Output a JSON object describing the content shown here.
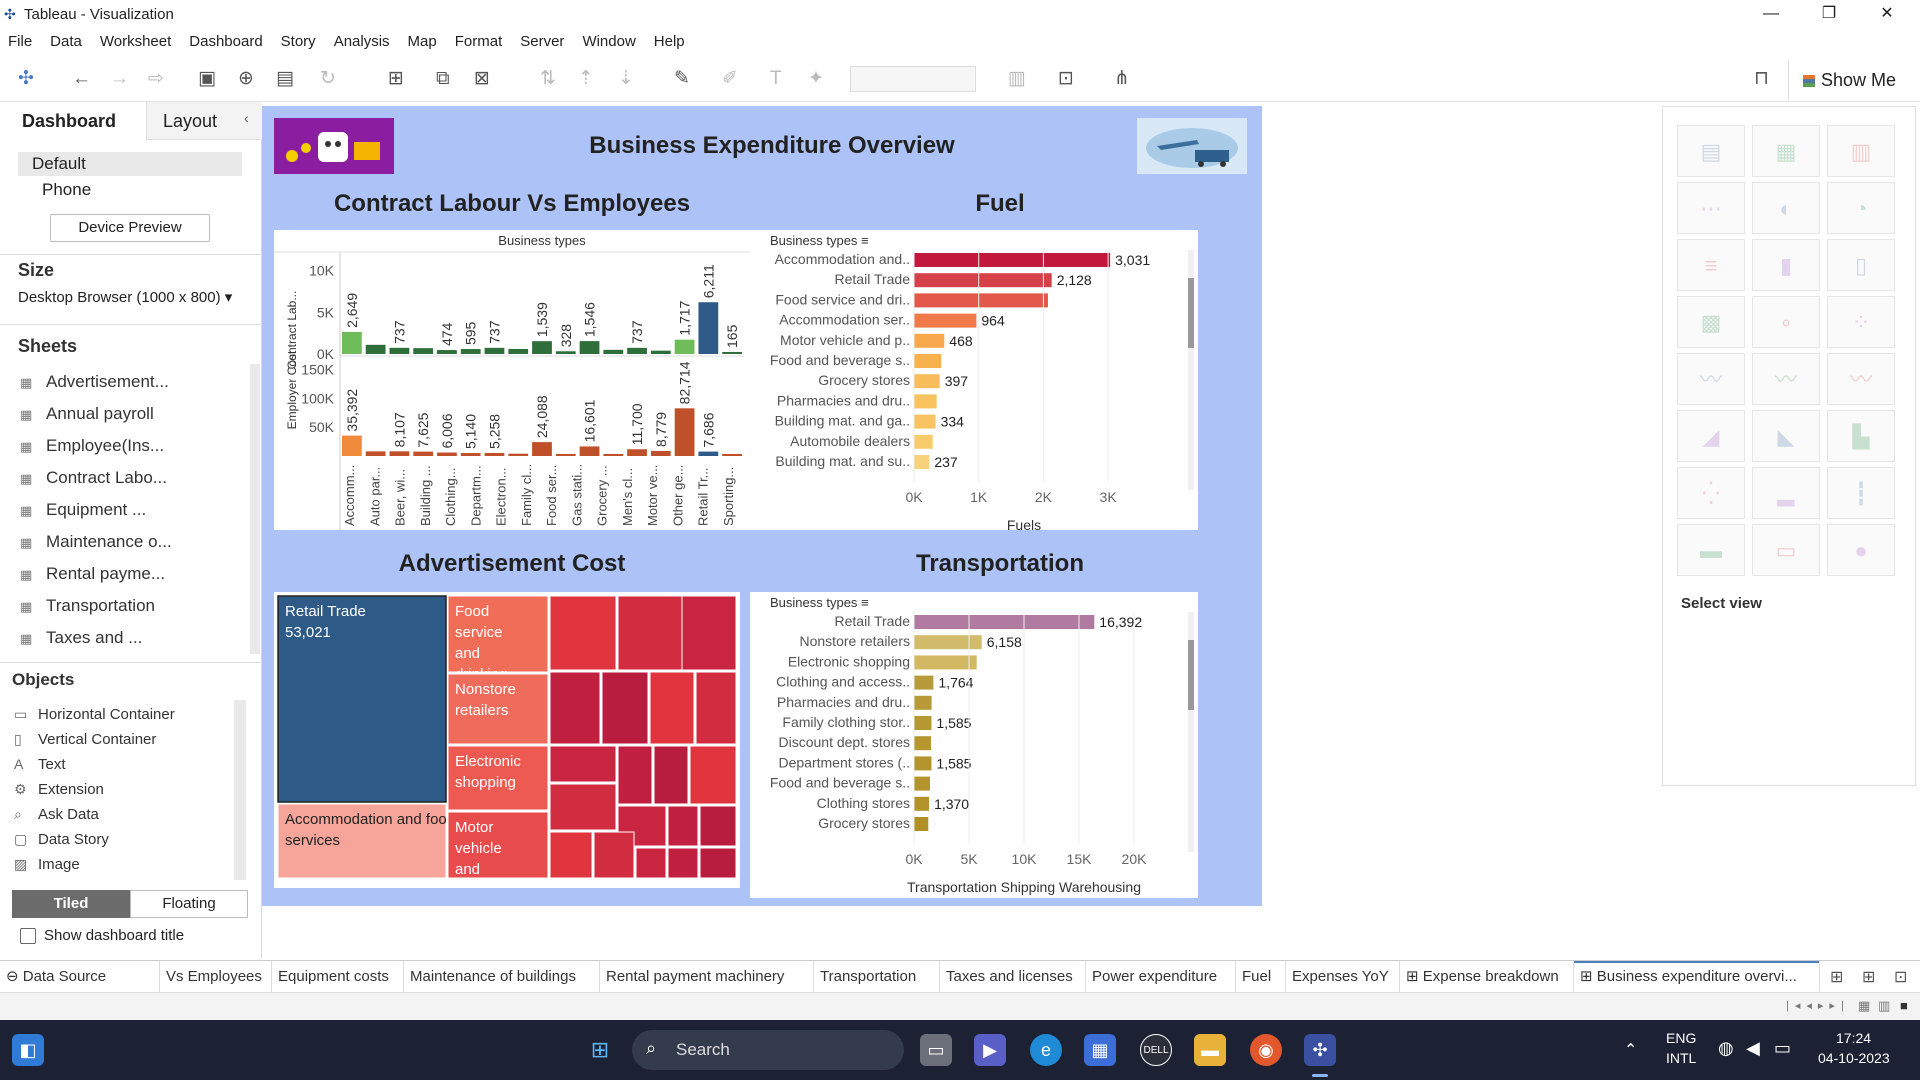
{
  "window": {
    "title": "Tableau - Visualization",
    "minimize": "—",
    "restore": "❐",
    "close": "✕"
  },
  "menu": [
    "File",
    "Data",
    "Worksheet",
    "Dashboard",
    "Story",
    "Analysis",
    "Map",
    "Format",
    "Server",
    "Window",
    "Help"
  ],
  "toolbar": {
    "show_me": "Show Me"
  },
  "left_pane": {
    "tabs": [
      "Dashboard",
      "Layout"
    ],
    "device_options": [
      "Default",
      "Phone"
    ],
    "device_preview": "Device Preview",
    "size_header": "Size",
    "size_value": "Desktop Browser (1000 x 800) ▾",
    "sheets_header": "Sheets",
    "sheets": [
      "Advertisement...",
      "Annual payroll",
      "Employee(Ins...",
      "Contract Labo...",
      "Equipment ...",
      "Maintenance o...",
      "Rental payme...",
      "Transportation",
      "Taxes and ..."
    ],
    "objects_header": "Objects",
    "objects": [
      {
        "icon": "horizontal-container-icon",
        "glyph": "▭",
        "label": "Horizontal Container"
      },
      {
        "icon": "vertical-container-icon",
        "glyph": "▯",
        "label": "Vertical Container"
      },
      {
        "icon": "text-icon",
        "glyph": "A",
        "label": "Text"
      },
      {
        "icon": "extension-icon",
        "glyph": "⚙",
        "label": "Extension"
      },
      {
        "icon": "ask-data-icon",
        "glyph": "⌕",
        "label": "Ask Data"
      },
      {
        "icon": "data-story-icon",
        "glyph": "▢",
        "label": "Data Story"
      },
      {
        "icon": "image-icon",
        "glyph": "▨",
        "label": "Image"
      }
    ],
    "tiled": "Tiled",
    "floating": "Floating",
    "show_title": "Show dashboard title"
  },
  "dashboard": {
    "title": "Business Expenditure Overview",
    "contract_title": "Contract Labour Vs Employees",
    "fuel_title": "Fuel",
    "adv_title": "Advertisement Cost",
    "transport_title": "Transportation"
  },
  "chart_data": [
    {
      "type": "bar",
      "title": "Contract Labour Vs Employees",
      "column_header": "Business types",
      "categories": [
        "Accomm...",
        "Auto par...",
        "Beer, wi...",
        "Building ...",
        "Clothing...",
        "Departm...",
        "Electron...",
        "Family cl...",
        "Food ser...",
        "Gas stati...",
        "Grocery ...",
        "Men's cl...",
        "Motor ve...",
        "Other ge...",
        "Retail Tr...",
        "Sporting..."
      ],
      "series": [
        {
          "name": "Contract Lab...",
          "ylim": [
            0,
            12000
          ],
          "ticks": [
            "10K",
            "5K",
            "0K"
          ],
          "values": [
            2649,
            1100,
            737,
            700,
            474,
            595,
            737,
            600,
            1539,
            328,
            1546,
            500,
            737,
            400,
            1717,
            6211,
            165
          ],
          "labels": [
            "2,649",
            "",
            "737",
            "",
            "474",
            "595",
            "737",
            "",
            "1,539",
            "328",
            "1,546",
            "",
            "737",
            "",
            "1,717",
            "6,211",
            "165"
          ]
        },
        {
          "name": "Employer Cost",
          "ylim": [
            0,
            170000
          ],
          "ticks": [
            "150K",
            "100K",
            "50K"
          ],
          "values": [
            35392,
            8000,
            8107,
            7625,
            6006,
            5140,
            5258,
            4000,
            24088,
            3000,
            16601,
            3000,
            11700,
            8779,
            82714,
            7686,
            2000
          ],
          "labels": [
            "35,392",
            "",
            "8,107",
            "7,625",
            "6,006",
            "5,140",
            "5,258",
            "",
            "24,088",
            "",
            "16,601",
            "",
            "11,700",
            "8,779",
            "82,714",
            "7,686",
            ""
          ]
        }
      ]
    },
    {
      "type": "bar",
      "title": "Fuel",
      "orientation": "horizontal",
      "column_header": "Business types",
      "xlabel": "Fuels",
      "ticks": [
        "0K",
        "1K",
        "2K",
        "3K"
      ],
      "xlim": [
        0,
        3400
      ],
      "categories": [
        "Accommodation and..",
        "Retail Trade",
        "Food service and dri..",
        "Accommodation ser..",
        "Motor vehicle and p..",
        "Food and beverage s..",
        "Grocery stores",
        "Pharmacies and dru..",
        "Building mat. and ga..",
        "Automobile dealers",
        "Building mat. and su.."
      ],
      "values": [
        3031,
        2128,
        2070,
        964,
        468,
        420,
        397,
        350,
        334,
        290,
        237
      ],
      "labels": [
        "3,031",
        "2,128",
        "",
        "964",
        "468",
        "",
        "397",
        "",
        "334",
        "",
        "237"
      ],
      "colors": [
        "#c2183d",
        "#d6404a",
        "#e2584a",
        "#f07a4a",
        "#f7a84c",
        "#f7b24e",
        "#f8bc5a",
        "#f8c25e",
        "#f8c462",
        "#f8cc6a",
        "#f8d27a"
      ]
    },
    {
      "type": "heatmap",
      "title": "Advertisement Cost",
      "cells": [
        {
          "label": "Retail Trade",
          "value": "53,021",
          "color": "#2e5a87"
        },
        {
          "label": "Accommodation and food services",
          "value": "",
          "color": "#f7a59a"
        },
        {
          "label": "Food service and drinking",
          "value": "",
          "color": "#f06e58"
        },
        {
          "label": "Nonstore retailers",
          "value": "",
          "color": "#ef6b5c"
        },
        {
          "label": "Electronic shopping",
          "value": "",
          "color": "#ec5a52"
        },
        {
          "label": "Motor vehicle and",
          "value": "",
          "color": "#e84b4b"
        }
      ]
    },
    {
      "type": "bar",
      "title": "Transportation",
      "orientation": "horizontal",
      "column_header": "Business types",
      "xlabel": "Transportation Shipping Warehousing",
      "ticks": [
        "0K",
        "5K",
        "10K",
        "15K",
        "20K"
      ],
      "xlim": [
        0,
        20000
      ],
      "categories": [
        "Retail Trade",
        "Nonstore retailers",
        "Electronic shopping",
        "Clothing and access..",
        "Pharmacies and dru..",
        "Family clothing stor..",
        "Discount dept. stores",
        "Department stores (..",
        "Food and beverage s..",
        "Clothing stores",
        "Grocery stores"
      ],
      "values": [
        16392,
        6158,
        5700,
        1764,
        1600,
        1585,
        1550,
        1585,
        1450,
        1370,
        1300
      ],
      "labels": [
        "16,392",
        "6,158",
        "",
        "1,764",
        "",
        "1,585",
        "",
        "1,585",
        "",
        "1,370",
        ""
      ],
      "colors": [
        "#b07aa1",
        "#d2bb6a",
        "#d2b862",
        "#b79a3a",
        "#b89a38",
        "#b69832",
        "#b5962f",
        "#b4952d",
        "#b3932b",
        "#b29229",
        "#b19127"
      ]
    }
  ],
  "right_pane": {
    "select_view": "Select view"
  },
  "sheet_tabs": [
    "Data Source",
    "Vs Employees",
    "Equipment costs",
    "Maintenance of buildings",
    "Rental payment machinery",
    "Transportation",
    "Taxes and licenses",
    "Power expenditure",
    "Fuel",
    "Expenses YoY",
    "Expense breakdown",
    "Business expenditure overvi..."
  ],
  "taskbar": {
    "search": "Search",
    "lang1": "ENG",
    "lang2": "INTL",
    "time": "17:24",
    "date": "04-10-2023"
  },
  "colors": {
    "canvas": "#adc3f7",
    "contract_green": "#2f7a3b",
    "employer_orange": "#c8502a",
    "highlight_blue": "#2e5a87"
  }
}
